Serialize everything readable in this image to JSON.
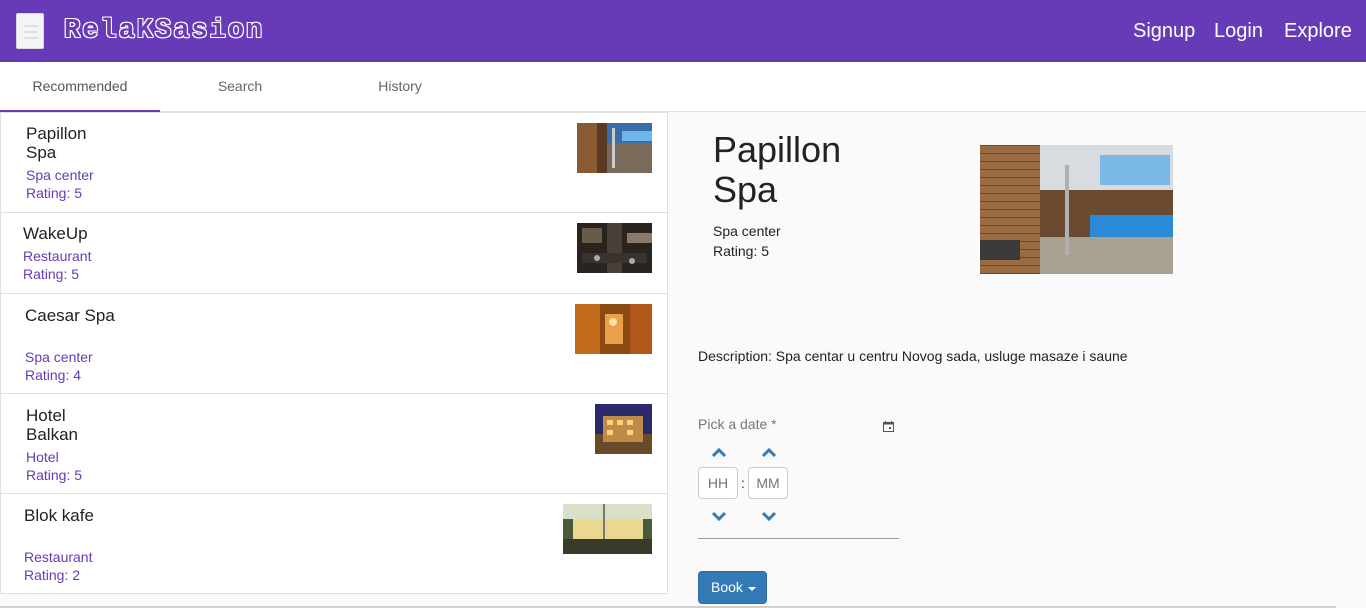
{
  "app": {
    "logo_text": "RelaKSasion",
    "brand_color": "#673ab7"
  },
  "header": {
    "menu_icon": "hamburger-icon",
    "nav": {
      "signup": "Signup",
      "login": "Login",
      "explore": "Explore"
    }
  },
  "tabs": [
    {
      "label": "Recommended",
      "active": true
    },
    {
      "label": "Search",
      "active": false
    },
    {
      "label": "History",
      "active": false
    }
  ],
  "places": [
    {
      "name": "Papillon Spa",
      "category": "Spa center",
      "rating": "Rating: 5"
    },
    {
      "name": "WakeUp",
      "category": "Restaurant",
      "rating": "Rating: 5"
    },
    {
      "name": "Caesar Spa",
      "category": "Spa center",
      "rating": "Rating: 4"
    },
    {
      "name": "Hotel Balkan",
      "category": "Hotel",
      "rating": "Rating: 5"
    },
    {
      "name": "Blok kafe",
      "category": "Restaurant",
      "rating": "Rating: 2"
    }
  ],
  "detail": {
    "name": "Papillon Spa",
    "category": "Spa center",
    "rating": "Rating: 5",
    "description": "Description: Spa centar u centru Novog sada, usluge masaze i saune"
  },
  "booking": {
    "date_label": "Pick a date *",
    "hour_placeholder": "HH",
    "minute_placeholder": "MM",
    "separator": ":",
    "book_label": "Book",
    "button_color": "#337ab7"
  }
}
